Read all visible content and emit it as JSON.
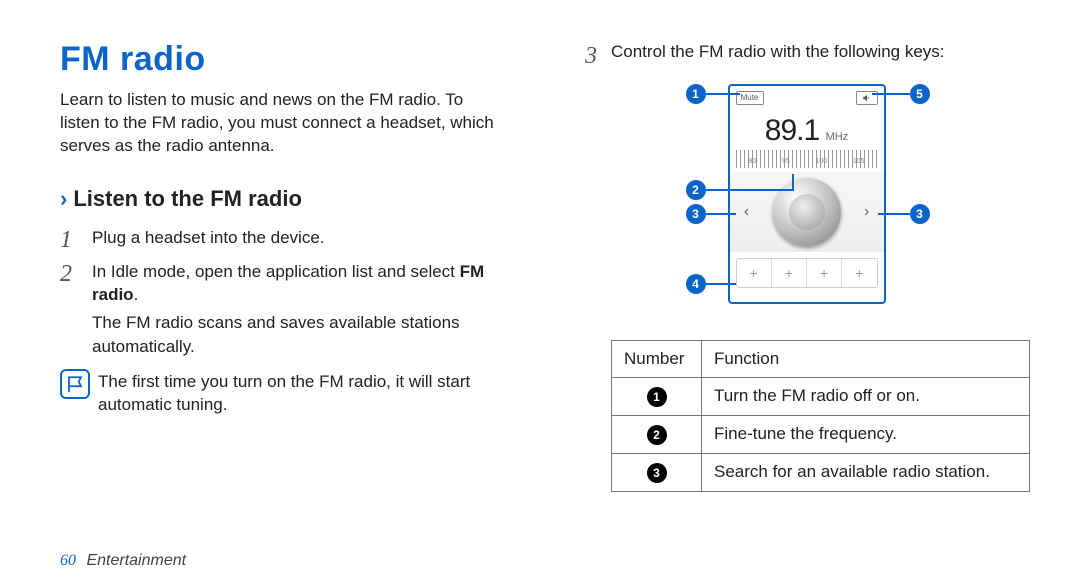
{
  "title": "FM radio",
  "intro": "Learn to listen to music and news on the FM radio. To listen to the FM radio, you must connect a headset, which serves as the radio antenna.",
  "subheading": "Listen to the FM radio",
  "steps": {
    "s1": {
      "num": "1",
      "text": "Plug a headset into the device."
    },
    "s2": {
      "num": "2",
      "text_a": "In Idle mode, open the application list and select ",
      "bold1": "FM radio",
      "text_b": ".",
      "sub": "The FM radio scans and saves available stations automatically."
    },
    "s3": {
      "num": "3",
      "text": "Control the FM radio with the following keys:"
    }
  },
  "note": "The first time you turn on the FM radio, it will start automatic tuning.",
  "radio": {
    "mute": "Mute",
    "freq": "89.1",
    "unit": "MHz",
    "ticks": [
      "90",
      "95",
      "100",
      "105"
    ],
    "presets": [
      "+",
      "+",
      "+",
      "+"
    ],
    "callouts": {
      "c1": "1",
      "c2": "2",
      "c3a": "3",
      "c3b": "3",
      "c4": "4",
      "c5": "5"
    }
  },
  "table": {
    "head_num": "Number",
    "head_fn": "Function",
    "rows": [
      {
        "n": "1",
        "fn": "Turn the FM radio off or on."
      },
      {
        "n": "2",
        "fn": "Fine-tune the frequency."
      },
      {
        "n": "3",
        "fn": "Search for an available radio station."
      }
    ]
  },
  "footer": {
    "page": "60",
    "section": "Entertainment"
  }
}
